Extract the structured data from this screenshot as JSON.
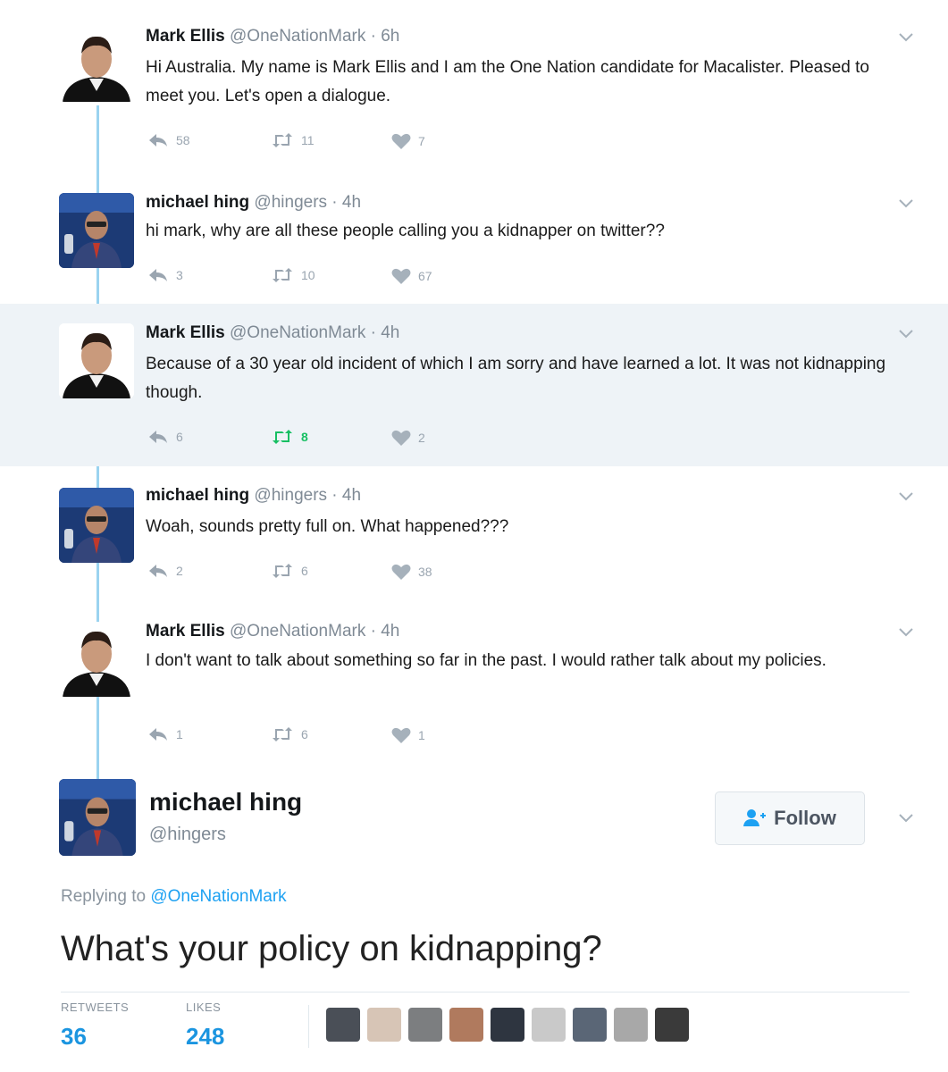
{
  "thread": [
    {
      "name": "Mark Ellis",
      "handle": "@OneNationMark",
      "time": "6h",
      "text": "Hi Australia. My name is Mark Ellis and I am the One Nation candidate for Macalister. Pleased to meet you. Let's open a dialogue.",
      "replies": "58",
      "retweets": "11",
      "likes": "7"
    },
    {
      "name": "michael hing",
      "handle": "@hingers",
      "time": "4h",
      "text": "hi mark, why are all these people calling you a kidnapper on twitter??",
      "replies": "3",
      "retweets": "10",
      "likes": "67"
    },
    {
      "name": "Mark Ellis",
      "handle": "@OneNationMark",
      "time": "4h",
      "text": "Because of a 30 year old incident of which I am sorry and have learned a lot. It was not kidnapping though.",
      "replies": "6",
      "retweets": "8",
      "likes": "2"
    },
    {
      "name": "michael hing",
      "handle": "@hingers",
      "time": "4h",
      "text": "Woah, sounds pretty full on. What happened???",
      "replies": "2",
      "retweets": "6",
      "likes": "38"
    },
    {
      "name": "Mark Ellis",
      "handle": "@OneNationMark",
      "time": "4h",
      "text": "I don't want to talk about something so far in the past. I would rather talk about my policies.",
      "replies": "1",
      "retweets": "6",
      "likes": "1"
    }
  ],
  "focused": {
    "name": "michael hing",
    "handle": "@hingers",
    "follow_label": "Follow",
    "replying_prefix": "Replying to",
    "replying_to": "@OneNationMark",
    "text": "What's your policy on kidnapping?",
    "retweets_label": "RETWEETS",
    "retweets_count": "36",
    "likes_label": "LIKES",
    "likes_count": "248"
  },
  "colors": {
    "accent": "#1da1f2",
    "retweet_active": "#17bf63",
    "thread_line": "#9ad3f0",
    "highlight_bg": "#eef3f7"
  }
}
